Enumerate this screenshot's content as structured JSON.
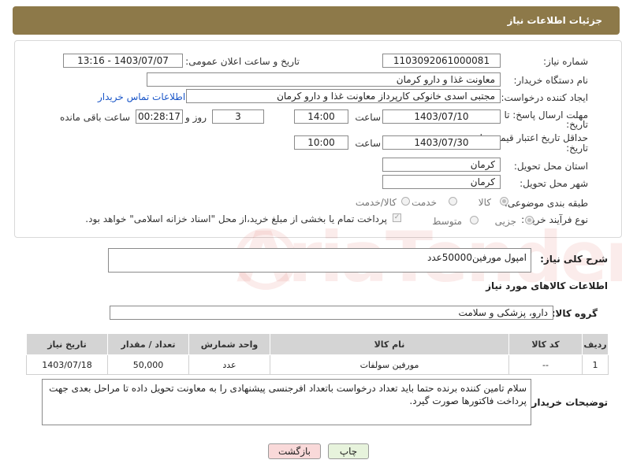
{
  "header": {
    "title": "جزئیات اطلاعات نیاز"
  },
  "form": {
    "need_number": {
      "label": "شماره نیاز:",
      "value": "1103092061000081"
    },
    "announce": {
      "label": "تاریخ و ساعت اعلان عمومی:",
      "value": "1403/07/07 - 13:16"
    },
    "buyer_org": {
      "label": "نام دستگاه خریدار:",
      "value": "معاونت غذا و دارو کرمان"
    },
    "creator": {
      "label": "ایجاد کننده درخواست:",
      "value": "مجتبی اسدی خانوکی کارپرداز  معاونت غذا و دارو کرمان",
      "contact_link": "اطلاعات تماس خریدار"
    },
    "reply_deadline": {
      "label_line1": "مهلت ارسال پاسخ: تا",
      "label_line2": "تاریخ:",
      "date": "1403/07/10",
      "time_label": "ساعت",
      "time": "14:00",
      "days": "3",
      "days_label": "روز و",
      "remaining": "00:28:17",
      "remaining_label": "ساعت باقی مانده"
    },
    "price_validity": {
      "label_line1": "حداقل تاریخ اعتبار قیمت: تا",
      "label_line2": "تاریخ:",
      "date": "1403/07/30",
      "time_label": "ساعت",
      "time": "10:00"
    },
    "province": {
      "label": "استان محل تحویل:",
      "value": "کرمان"
    },
    "city": {
      "label": "شهر محل تحویل:",
      "value": "کرمان"
    },
    "category": {
      "label": "طبقه بندی موضوعی:",
      "options": [
        "کالا",
        "خدمت",
        "کالا/خدمت"
      ]
    },
    "process": {
      "label": "نوع فرآیند خرید :",
      "options": [
        "جزیی",
        "متوسط"
      ],
      "payment_note": "پرداخت تمام یا بخشی از مبلغ خرید،از محل \"اسناد خزانه اسلامی\" خواهد بود."
    }
  },
  "summary": {
    "label": "شرح کلی نیاز:",
    "value": "امپول مورفین50000عدد"
  },
  "goods_info": {
    "title": "اطلاعات کالاهای مورد نیاز"
  },
  "goods_group": {
    "label": "گروه کالا:",
    "value": "دارو، پزشکی و سلامت"
  },
  "table": {
    "headers": [
      "ردیف",
      "کد کالا",
      "نام کالا",
      "واحد شمارش",
      "تعداد / مقدار",
      "تاریخ نیاز"
    ],
    "rows": [
      [
        "1",
        "--",
        "مورفین سولفات",
        "عدد",
        "50,000",
        "1403/07/18"
      ]
    ]
  },
  "buyer_notes": {
    "label": "توضیحات خریدار:",
    "value": "سلام تامین کننده برنده حتما باید تعداد درخواست باتعداد افرجنسی پیشنهادی را به معاونت تحویل داده تا مراحل بعدی جهت پرداخت فاکتورها صورت گیرد."
  },
  "buttons": {
    "print": "چاپ",
    "back": "بازگشت"
  },
  "watermark": {
    "text": "AriaTender.neT"
  },
  "colors": {
    "header_bg": "#8d7949",
    "link": "#1a56c8",
    "back_button_bg": "#f9d9d9",
    "print_button_bg": "#e7f3dc"
  }
}
